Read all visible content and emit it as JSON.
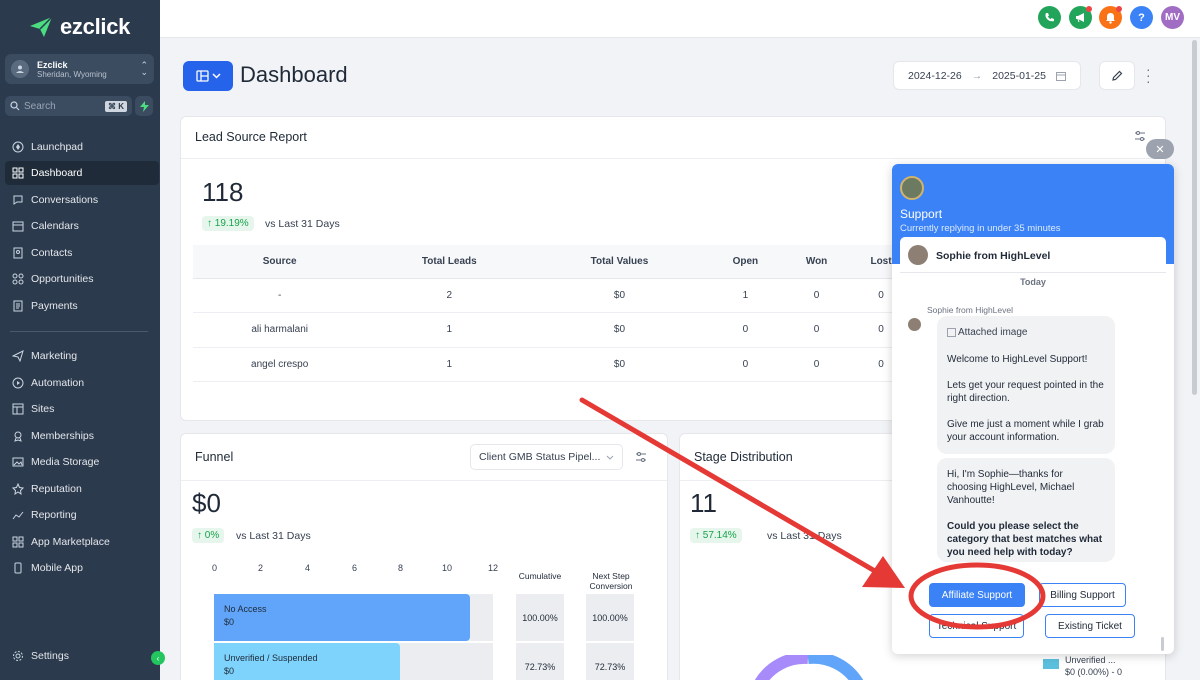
{
  "sidebar": {
    "brand": "ezclick",
    "account": {
      "name": "Ezclick",
      "location": "Sheridan, Wyoming"
    },
    "search_placeholder": "Search",
    "search_shortcut": "⌘ K",
    "items": [
      {
        "label": "Launchpad",
        "icon": "rocket-icon"
      },
      {
        "label": "Dashboard",
        "icon": "grid-icon"
      },
      {
        "label": "Conversations",
        "icon": "chat-icon"
      },
      {
        "label": "Calendars",
        "icon": "calendar-icon"
      },
      {
        "label": "Contacts",
        "icon": "contacts-icon"
      },
      {
        "label": "Opportunities",
        "icon": "opportunities-icon"
      },
      {
        "label": "Payments",
        "icon": "payments-icon"
      },
      {
        "label": "Marketing",
        "icon": "send-icon"
      },
      {
        "label": "Automation",
        "icon": "automation-icon"
      },
      {
        "label": "Sites",
        "icon": "sites-icon"
      },
      {
        "label": "Memberships",
        "icon": "memberships-icon"
      },
      {
        "label": "Media Storage",
        "icon": "media-icon"
      },
      {
        "label": "Reputation",
        "icon": "star-icon"
      },
      {
        "label": "Reporting",
        "icon": "reporting-icon"
      },
      {
        "label": "App Marketplace",
        "icon": "marketplace-icon"
      },
      {
        "label": "Mobile App",
        "icon": "mobile-icon"
      }
    ],
    "settings": "Settings"
  },
  "topbar": {
    "avatar_initials": "MV",
    "help": "?"
  },
  "header": {
    "title": "Dashboard",
    "date_start": "2024-12-26",
    "date_end": "2025-01-25"
  },
  "lead_source": {
    "title": "Lead Source Report",
    "total": "118",
    "change": "↑ 19.19%",
    "vs": "vs Last 31 Days",
    "columns": [
      "Source",
      "Total Leads",
      "Total Values",
      "Open",
      "Won",
      "Lost"
    ],
    "rows": [
      [
        "-",
        "2",
        "$0",
        "1",
        "0",
        "0"
      ],
      [
        "ali harmalani",
        "1",
        "$0",
        "0",
        "0",
        "0"
      ],
      [
        "angel crespo",
        "1",
        "$0",
        "0",
        "0",
        "0"
      ]
    ]
  },
  "funnel": {
    "title": "Funnel",
    "pipeline": "Client GMB Status Pipel...",
    "total": "$0",
    "change": "↑ 0%",
    "vs": "vs Last 31 Days",
    "axis": [
      "0",
      "2",
      "4",
      "6",
      "8",
      "10",
      "12"
    ],
    "cumulative_label": "Cumulative",
    "next_step_label": "Next Step Conversion",
    "stages": [
      {
        "name": "No Access",
        "value": "$0",
        "count": 11,
        "cumulative": "100.00%",
        "next": "100.00%",
        "color": "#60a5fa"
      },
      {
        "name": "Unverified / Suspended",
        "value": "$0",
        "count": 8,
        "cumulative": "72.73%",
        "next": "72.73%",
        "color": "#7dd3fc"
      }
    ]
  },
  "stage_distribution": {
    "title": "Stage Distribution",
    "total": "11",
    "change": "↑ 57.14%",
    "vs": "vs Last 31 Days",
    "legend": [
      {
        "name": "Unverified ...",
        "value": "$0 (0.00%) - 0",
        "color": "#5bc0de"
      }
    ]
  },
  "chat": {
    "title": "Support",
    "subtitle": "Currently replying in under 35 minutes",
    "agent": "Sophie from HighLevel",
    "day": "Today",
    "sender": "Sophie from HighLevel",
    "attached": "Attached image",
    "msg1a": "Welcome to HighLevel Support!",
    "msg1b": "Lets get your request pointed in the right direction.",
    "msg1c": "Give me just a moment while I grab your account information.",
    "msg2a": "Hi, I'm Sophie—thanks for choosing HighLevel, Michael Vanhoutte!",
    "msg2b": "Could you please select the category that best matches what you need help with today?",
    "options": [
      "Affiliate Support",
      "Billing Support",
      "Technical Support",
      "Existing Ticket"
    ]
  }
}
